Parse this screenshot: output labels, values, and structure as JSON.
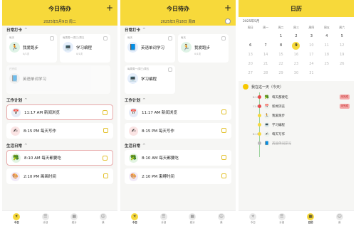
{
  "colors": {
    "accent": "#f7d93a",
    "timeline": "#9fd49f",
    "alert": "#e84a4a"
  },
  "screen1": {
    "title": "今日待办",
    "plus": "+",
    "date": "2025年5月9日 周二",
    "checkin_label": "日常打卡",
    "checkin_cards": [
      {
        "sub": "每天",
        "name": "我爱跑步",
        "meta": "0/1次",
        "icon": "runner-icon",
        "glyph": "🏃"
      },
      {
        "sub": "每周周一/周三/周五",
        "name": "学习编程",
        "meta": "0/1次",
        "icon": "laptop-icon",
        "glyph": "💻"
      }
    ],
    "checkin_done": {
      "sub": "已完成",
      "name": "英语单词学习",
      "meta": "",
      "icon": "book-icon",
      "glyph": "📘"
    },
    "work_label": "工作计划",
    "work_items": [
      {
        "text": "11:17 AM 新闻浏览",
        "icon": "calendar-icon",
        "glyph": "📅"
      },
      {
        "text": "8:15 PM 每天写作",
        "icon": "pen-icon",
        "glyph": "✍"
      }
    ],
    "life_label": "生活日常",
    "life_items": [
      {
        "text": "8:10 AM 每天都要吃",
        "icon": "broccoli-icon",
        "glyph": "🥦"
      },
      {
        "text": "2:10 PM 画画时间",
        "icon": "palette-icon",
        "glyph": "🎨"
      }
    ],
    "tabs": [
      "今日",
      "计划",
      "统计",
      "我"
    ]
  },
  "screen2": {
    "title": "今日待办",
    "plus": "+",
    "date": "2025年5月18日 周四",
    "checkin_label": "日常打卡",
    "checkin_cards": [
      {
        "sub": "每天",
        "name": "英语单词学习",
        "meta": "",
        "icon": "book-icon",
        "glyph": "📘"
      },
      {
        "sub": "每天",
        "name": "我爱跑步",
        "meta": "0/1次",
        "icon": "runner-icon",
        "glyph": "🏃"
      }
    ],
    "checkin_single": {
      "sub": "每周周一/周三/周五",
      "name": "学习编程",
      "meta": "",
      "icon": "laptop-icon",
      "glyph": "💻"
    },
    "work_label": "工作计划",
    "work_items": [
      {
        "text": "11:17 AM 新闻浏览",
        "icon": "calendar-icon",
        "glyph": "📅"
      },
      {
        "text": "8:15 PM 每天写作",
        "icon": "pen-icon",
        "glyph": "✍"
      }
    ],
    "life_label": "生活日常",
    "life_items": [
      {
        "text": "8:10 AM 每天都要吃",
        "icon": "broccoli-icon",
        "glyph": "🥦"
      },
      {
        "text": "2:10 PM 束缚时间",
        "icon": "palette-icon",
        "glyph": "🎨"
      }
    ],
    "tabs": [
      "今日",
      "计划",
      "统计",
      "我"
    ]
  },
  "screen3": {
    "title": "日历",
    "month": "2025年5月",
    "weekdays": [
      "周日",
      "周一",
      "周二",
      "周三",
      "周四",
      "周五",
      "周六"
    ],
    "days": [
      "",
      "",
      "1",
      "2",
      "3",
      "4",
      "5",
      "6",
      "7",
      "8",
      "9",
      "10",
      "11",
      "12",
      "13",
      "14",
      "15",
      "16",
      "17",
      "18",
      "19",
      "20",
      "21",
      "22",
      "23",
      "24",
      "25",
      "26",
      "27",
      "28",
      "29",
      "30",
      "31",
      "",
      ""
    ],
    "today": "9",
    "timeline_head": "我在这一天（今天）",
    "timeline": [
      {
        "time": "8:10...",
        "label": "每天都要吃",
        "tag": "未完成",
        "strike": false,
        "glyph": "🥦"
      },
      {
        "time": "11:17...",
        "label": "新闻浏览",
        "tag": "未完成",
        "strike": false,
        "glyph": "📅"
      },
      {
        "time": "",
        "label": "我爱跑步",
        "tag": "",
        "strike": false,
        "glyph": "🏃"
      },
      {
        "time": "",
        "label": "学习编程",
        "tag": "",
        "strike": false,
        "glyph": "💻"
      },
      {
        "time": "8:15...",
        "label": "每天写作",
        "tag": "",
        "strike": false,
        "glyph": "✍"
      },
      {
        "time": "",
        "label": "英语单词学习",
        "tag": "",
        "strike": true,
        "glyph": "📘"
      },
      {
        "time": "",
        "label": "",
        "tag": "",
        "strike": false,
        "glyph": ""
      }
    ],
    "tabs": [
      "今日",
      "计划",
      "日历",
      "我"
    ]
  }
}
